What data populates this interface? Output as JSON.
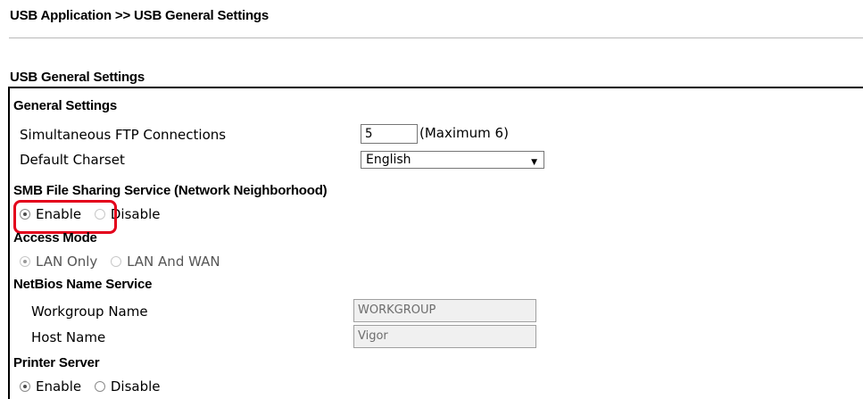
{
  "breadcrumb": "USB Application >> USB General Settings",
  "section_title": "USB General Settings",
  "general": {
    "heading": "General Settings",
    "ftp_label": "Simultaneous FTP Connections",
    "ftp_value": "5",
    "ftp_hint": "(Maximum 6)",
    "charset_label": "Default Charset",
    "charset_value": "English"
  },
  "smb": {
    "heading": "SMB File Sharing Service (Network Neighborhood)",
    "enable_label": "Enable",
    "disable_label": "Disable",
    "selected": "Enable"
  },
  "access_mode": {
    "heading": "Access Mode",
    "lan_only_label": "LAN Only",
    "lan_wan_label": "LAN And WAN",
    "selected": "LAN Only"
  },
  "netbios": {
    "heading": "NetBios Name Service",
    "workgroup_label": "Workgroup Name",
    "workgroup_value": "WORKGROUP",
    "host_label": "Host Name",
    "host_value": "Vigor"
  },
  "printer": {
    "heading": "Printer Server",
    "enable_label": "Enable",
    "disable_label": "Disable",
    "selected": "Enable"
  },
  "colors": {
    "highlight": "#e3001b"
  }
}
